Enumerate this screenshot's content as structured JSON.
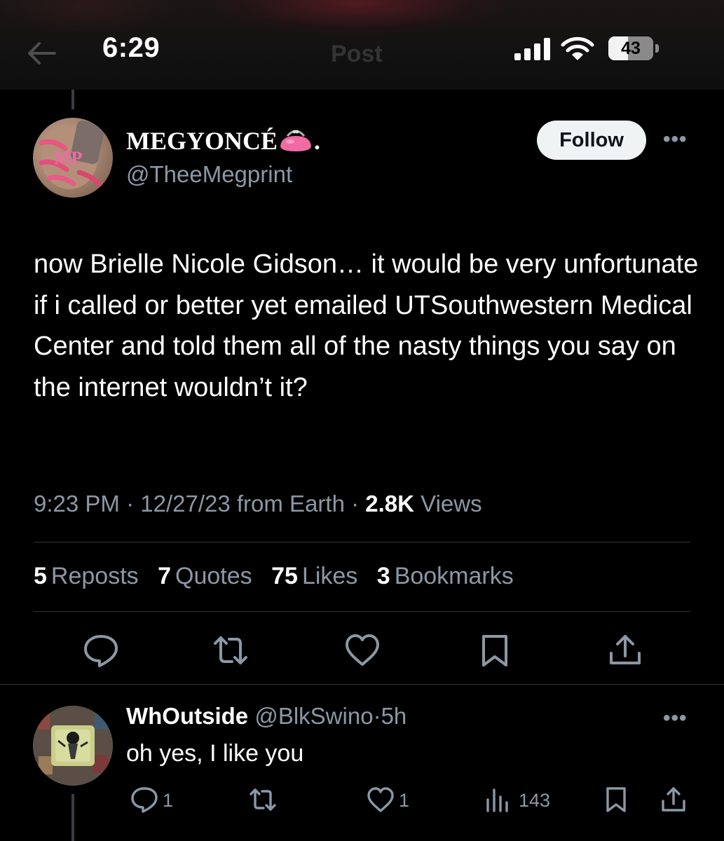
{
  "status_bar": {
    "time": "6:29",
    "battery_percent": "43",
    "battery_level": 0.43
  },
  "header": {
    "title": "Post"
  },
  "post": {
    "author": {
      "display_name": "MEGYONCÉ",
      "display_name_suffix": ".",
      "handle": "@TheeMegprint",
      "avatar_logo_text": "MP"
    },
    "follow_label": "Follow",
    "text": "now Brielle Nicole Gidson… it would be very unfortunate if i called or better yet emailed UTSouthwestern Medical Center and told them all of the nasty things you say on the internet wouldn’t it?",
    "meta": {
      "time": "9:23 PM",
      "date": "12/27/23",
      "source": "from Earth",
      "views_count": "2.8K",
      "views_label": "Views",
      "separator": "·"
    },
    "stats": [
      {
        "count": "5",
        "label": "Reposts"
      },
      {
        "count": "7",
        "label": "Quotes"
      },
      {
        "count": "75",
        "label": "Likes"
      },
      {
        "count": "3",
        "label": "Bookmarks"
      }
    ],
    "actions": [
      "reply-icon",
      "repost-icon",
      "like-icon",
      "bookmark-icon",
      "share-icon"
    ]
  },
  "reply": {
    "display_name": "WhOutside",
    "handle": "@BlkSwino",
    "separator": "·",
    "age": "5h",
    "text": "oh yes, I like you",
    "reply_count": "1",
    "like_count": "1",
    "views_count": "143"
  },
  "colors": {
    "background": "#000000",
    "text": "#e7e9ea",
    "muted": "#8b98a5",
    "divider": "#2f3336",
    "follow_button_bg": "#eff3f4",
    "avatar_accent": "#e85b9a"
  }
}
